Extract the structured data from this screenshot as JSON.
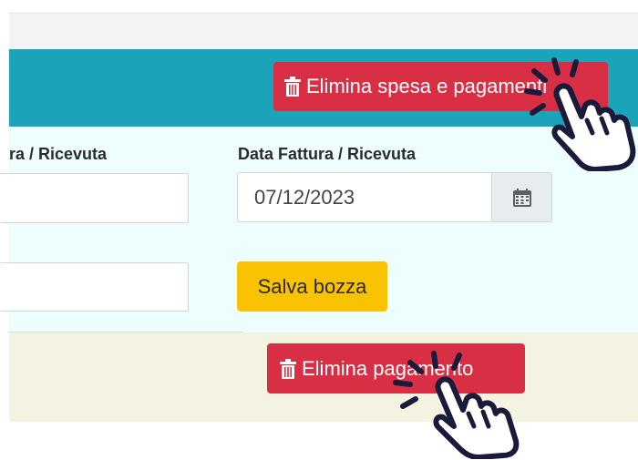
{
  "header": {
    "delete_expense_label": "Elimina spesa e pagamenti"
  },
  "form": {
    "left_label": "ra / Ricevuta",
    "right_label": "Data Fattura / Ricevuta",
    "date_value": "07/12/2023",
    "draft_label": "Salva bozza"
  },
  "payment": {
    "delete_payment_label": "Elimina pagamento"
  },
  "icons": {
    "delete_icon": "trash-icon",
    "calendar_icon": "calendar-icon",
    "pointer_icon": "hand-pointer-icon"
  },
  "colors": {
    "teal": "#1ba3b9",
    "danger": "#d92f45",
    "warning": "#f9c203",
    "panel": "#eefdfe",
    "beige": "#f4f2e0"
  }
}
